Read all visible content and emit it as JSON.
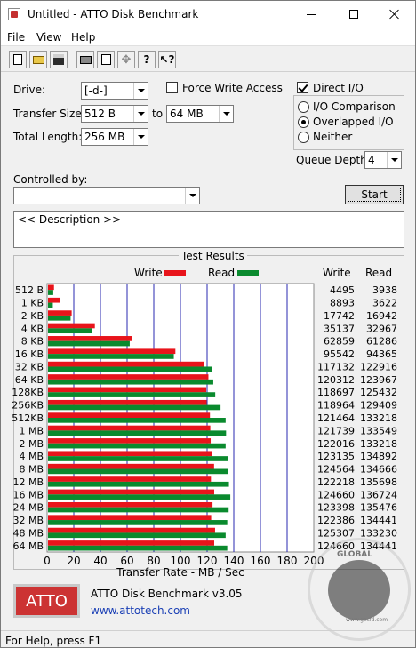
{
  "window": {
    "title": "Untitled - ATTO Disk Benchmark"
  },
  "menu": [
    "File",
    "View",
    "Help"
  ],
  "toolbar_icons": [
    "new-file-icon",
    "open-folder-icon",
    "save-disk-icon",
    "print-icon",
    "print-preview-icon",
    "move-icon",
    "help-icon",
    "whats-this-help-icon"
  ],
  "settings": {
    "drive_label": "Drive:",
    "drive_value": "[-d-]",
    "force_write_label": "Force Write Access",
    "force_write_checked": false,
    "direct_io_label": "Direct I/O",
    "direct_io_checked": true,
    "transfer_size_label": "Transfer Size:",
    "transfer_from": "512 B",
    "to_label": "to",
    "transfer_to": "64 MB",
    "total_length_label": "Total Length:",
    "total_length_value": "256 MB",
    "io_comparison_label": "I/O Comparison",
    "overlapped_io_label": "Overlapped I/O",
    "neither_label": "Neither",
    "selected_io_mode": "Overlapped I/O",
    "queue_depth_label": "Queue Depth:",
    "queue_depth_value": "4",
    "controlled_by_label": "Controlled by:",
    "controlled_by_value": "",
    "start_label": "Start",
    "description": "<< Description >>"
  },
  "results": {
    "title": "Test Results",
    "write_label": "Write",
    "read_label": "Read",
    "write_col": "Write",
    "read_col": "Read",
    "colors": {
      "write": "#e8141b",
      "read": "#0a8a2e"
    }
  },
  "chart_data": {
    "type": "bar",
    "orientation": "horizontal",
    "xlabel": "Transfer Rate - MB / Sec",
    "xlim": [
      0,
      200
    ],
    "xticks": [
      "0",
      "20",
      "40",
      "60",
      "80",
      "100",
      "120",
      "140",
      "160",
      "180",
      "200"
    ],
    "categories": [
      "512 B",
      "1 KB",
      "2 KB",
      "4 KB",
      "8 KB",
      "16 KB",
      "32 KB",
      "64 KB",
      "128KB",
      "256KB",
      "512KB",
      "1 MB",
      "2 MB",
      "4 MB",
      "8 MB",
      "12 MB",
      "16 MB",
      "24 MB",
      "32 MB",
      "48 MB",
      "64 MB"
    ],
    "series": [
      {
        "name": "Write",
        "values_kbps": [
          4495,
          8893,
          17742,
          35137,
          62859,
          95542,
          117132,
          120312,
          118697,
          118964,
          121464,
          121739,
          122016,
          123135,
          124564,
          122218,
          124660,
          123398,
          122386,
          125307,
          124660
        ],
        "labels": [
          "4495",
          "8893",
          "17742",
          "35137",
          "62859",
          "95542",
          "117132",
          "120312",
          "118697",
          "118964",
          "121464",
          "121739",
          "122016",
          "123135",
          "124564",
          "122218",
          "124660",
          "123398",
          "122386",
          "125307",
          "124660"
        ]
      },
      {
        "name": "Read",
        "values_kbps": [
          3938,
          3622,
          16942,
          32967,
          61286,
          94365,
          122916,
          123967,
          125432,
          129409,
          133218,
          133549,
          133218,
          134892,
          134666,
          135698,
          136724,
          135476,
          134441,
          133230,
          134441
        ],
        "labels": [
          "3938",
          "3622",
          "16942",
          "32967",
          "61286",
          "94365",
          "122916",
          "123967",
          "125432",
          "129409",
          "133218",
          "133549",
          "133218",
          "134892",
          "134666",
          "135698",
          "136724",
          "135476",
          "134441",
          "133230",
          "134441"
        ]
      }
    ],
    "grid": true
  },
  "brand": {
    "logo": "ATTO",
    "product": "ATTO Disk Benchmark v3.05",
    "link": "www.attotech.com",
    "watermark_top": "GLOBAL",
    "watermark_bottom": "www.gecid.com"
  },
  "status": {
    "text": "For Help, press F1"
  }
}
